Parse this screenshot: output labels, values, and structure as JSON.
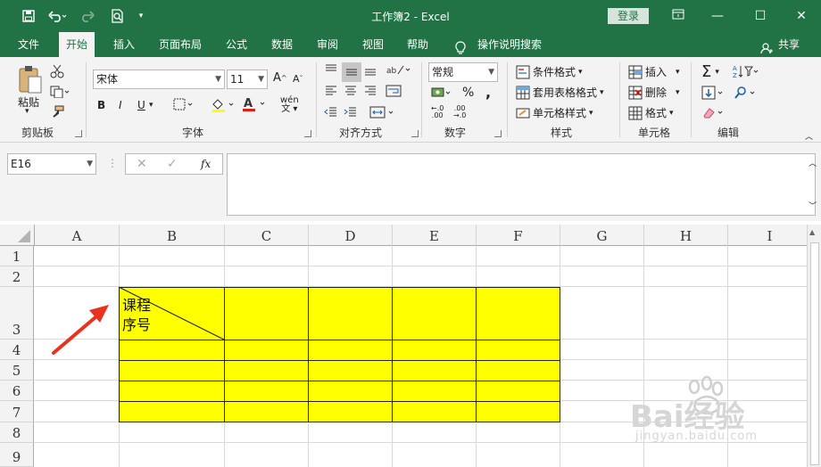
{
  "titlebar": {
    "title": "工作簿2  -  Excel",
    "login_label": "登录",
    "accent": "#217346"
  },
  "tabs": [
    "文件",
    "开始",
    "插入",
    "页面布局",
    "公式",
    "数据",
    "审阅",
    "视图",
    "帮助",
    "操作说明搜索"
  ],
  "share_label": "共享",
  "ribbon": {
    "clipboard": {
      "paste_label": "粘贴",
      "group_label": "剪贴板"
    },
    "font": {
      "font_name": "宋体",
      "font_size": "11",
      "group_label": "字体",
      "bold": "B",
      "italic": "I",
      "underline": "U",
      "wen": "wén"
    },
    "alignment": {
      "group_label": "对齐方式"
    },
    "number": {
      "format": "常规",
      "group_label": "数字",
      "percent": "%",
      "comma": ","
    },
    "styles": {
      "cond_format": "条件格式",
      "table_format": "套用表格格式",
      "cell_styles": "单元格样式",
      "group_label": "样式"
    },
    "cells": {
      "insert": "插入",
      "delete": "删除",
      "format": "格式",
      "group_label": "单元格"
    },
    "editing": {
      "group_label": "编辑"
    }
  },
  "formula_bar": {
    "name_box": "E16",
    "fx": "fx",
    "content": ""
  },
  "sheet": {
    "columns": [
      "A",
      "B",
      "C",
      "D",
      "E",
      "F",
      "G",
      "H",
      "I"
    ],
    "rows": [
      "1",
      "2",
      "3",
      "4",
      "5",
      "6",
      "7",
      "8",
      "9"
    ],
    "cell_b3_line1": "课程",
    "cell_b3_line2": "序号",
    "fill_color": "#ffff00"
  },
  "watermark": {
    "brand": "Bai经验",
    "url": "jingyan.baidu.com"
  }
}
